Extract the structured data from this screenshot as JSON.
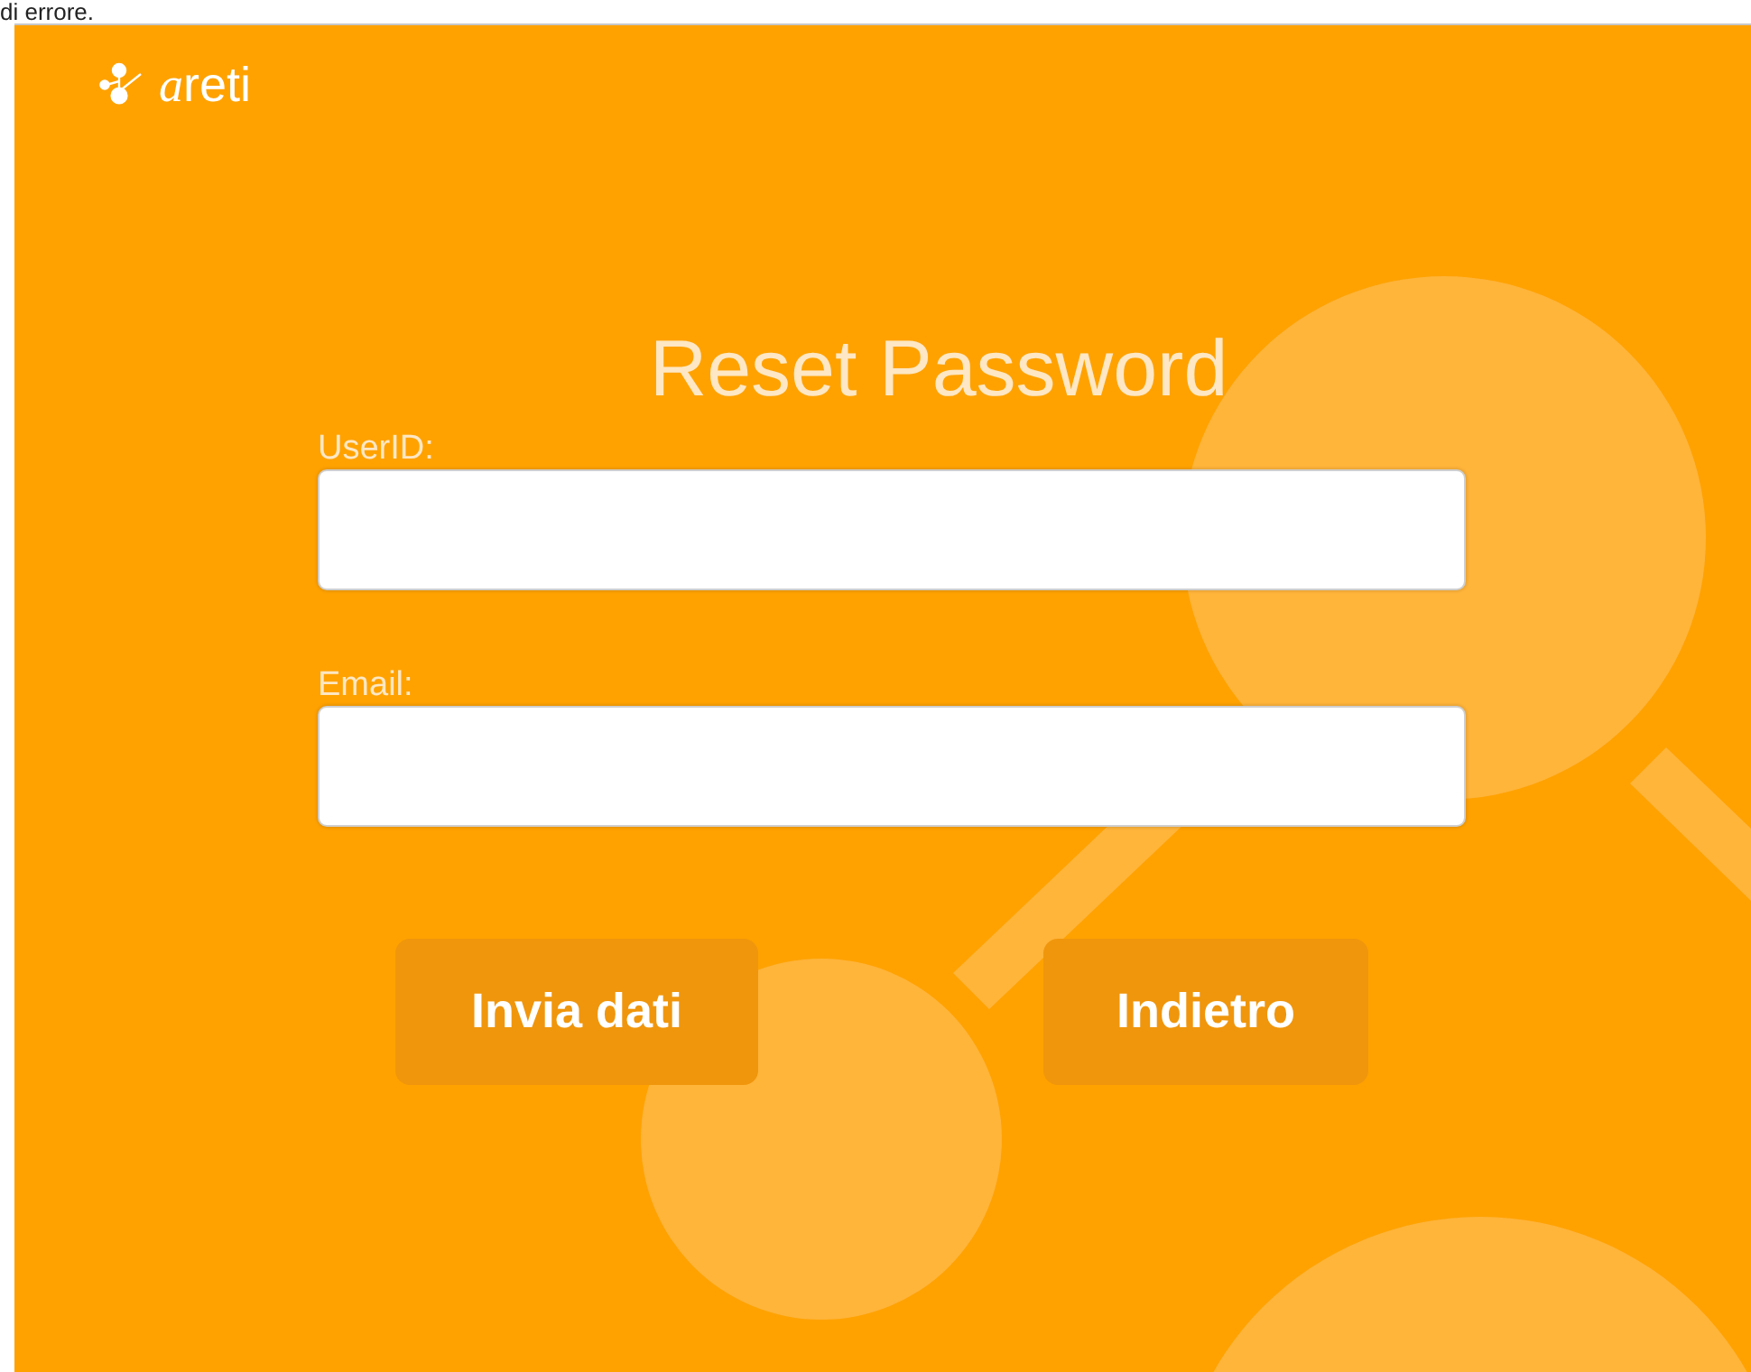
{
  "top_text": "di errore.",
  "logo": {
    "text": "areti"
  },
  "title": "Reset Password",
  "fields": [
    {
      "label": "UserID:"
    },
    {
      "label": "Email:"
    }
  ],
  "buttons": [
    "Invia dati",
    "Indietro"
  ]
}
